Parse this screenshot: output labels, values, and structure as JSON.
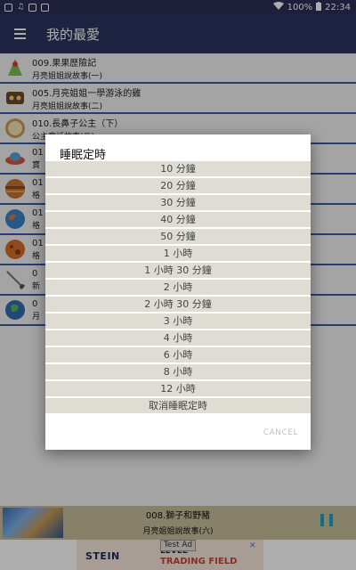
{
  "status_bar": {
    "battery": "100%",
    "time": "22:34"
  },
  "app_bar": {
    "title": "我的最愛"
  },
  "list": [
    {
      "title": "009.果果歷險記",
      "subtitle": "月亮姐姐說故事(一)"
    },
    {
      "title": "005.月亮姐姐一學游泳的雞",
      "subtitle": "月亮姐姐說故事(二)"
    },
    {
      "title": "010.長鼻子公主（下）",
      "subtitle": "公主童話故事(二)"
    },
    {
      "title": "01",
      "subtitle": "寶"
    },
    {
      "title": "01",
      "subtitle": "格"
    },
    {
      "title": "01",
      "subtitle": "格"
    },
    {
      "title": "01",
      "subtitle": "格"
    },
    {
      "title": "0",
      "subtitle": "新"
    },
    {
      "title": "0",
      "subtitle": "月"
    }
  ],
  "dialog": {
    "title": "睡眠定時",
    "options": [
      "10 分鐘",
      "20 分鐘",
      "30 分鐘",
      "40 分鐘",
      "50 分鐘",
      "1 小時",
      "1 小時 30 分鐘",
      "2 小時",
      "2 小時 30 分鐘",
      "3 小時",
      "4 小時",
      "6 小時",
      "8 小時",
      "12 小時",
      "取消睡眠定時"
    ],
    "cancel_label": "CANCEL"
  },
  "player": {
    "title": "008.獅子和野豬",
    "subtitle": "月亮姐姐說故事(六)"
  },
  "ad": {
    "brand": "STEIN",
    "line1": "LEVEL",
    "line2": "TRADING FIELD",
    "tag": "Test Ad",
    "close": "✕"
  },
  "colors": {
    "appbar": "#2d3460",
    "divider": "#3d5ba8",
    "option_bg": "#dfdcd4",
    "pause": "#19a2c8",
    "player_bg": "#c8be9d"
  }
}
